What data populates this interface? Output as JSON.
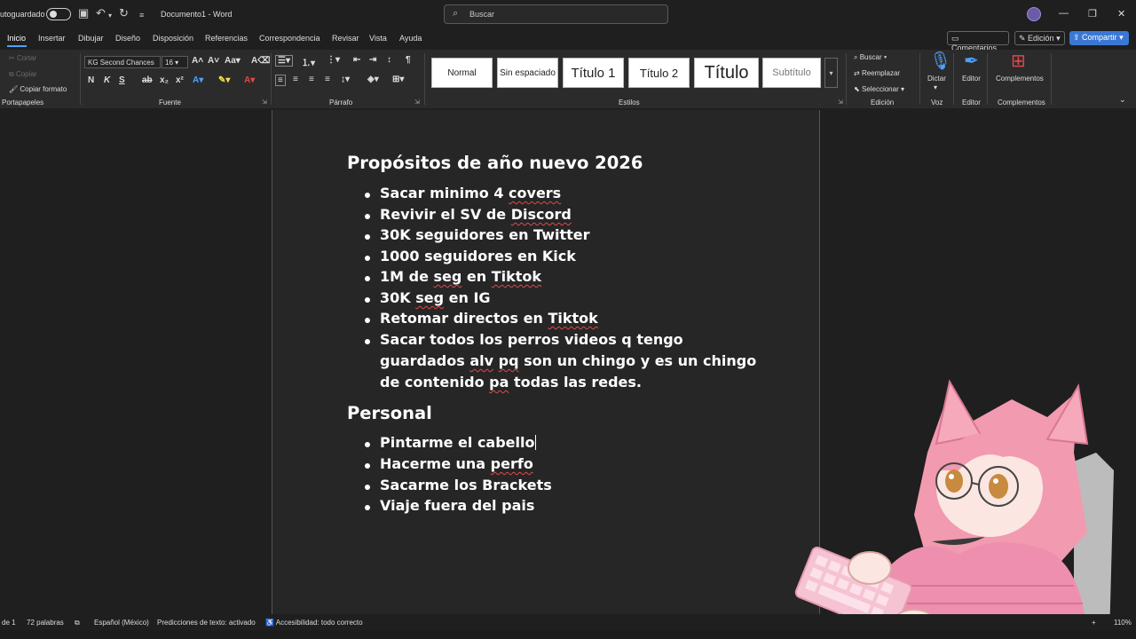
{
  "titlebar": {
    "autosave_label": "utoguardado",
    "doc_title": "Documento1 - Word",
    "search_placeholder": "Buscar"
  },
  "tabs": [
    "Inicio",
    "Insertar",
    "Dibujar",
    "Diseño",
    "Disposición",
    "Referencias",
    "Correspondencia",
    "Revisar",
    "Vista",
    "Ayuda"
  ],
  "actions": {
    "comments": "Comentarios",
    "edit": "Edición",
    "share": "Compartir"
  },
  "ribbon": {
    "clipboard": {
      "cut": "Cortar",
      "copy": "Copiar",
      "format_painter": "Copiar formato",
      "label": "Portapapeles"
    },
    "font": {
      "name": "KG Second Chances",
      "size": "16",
      "label": "Fuente"
    },
    "paragraph": {
      "label": "Párrafo"
    },
    "styles": {
      "items": [
        "Normal",
        "Sin espaciado",
        "Título 1",
        "Título 2",
        "Título",
        "Subtítulo"
      ],
      "label": "Estilos"
    },
    "editing": {
      "find": "Buscar",
      "replace": "Reemplazar",
      "select": "Seleccionar",
      "label": "Edición"
    },
    "voice": {
      "dictate": "Dictar",
      "label": "Voz"
    },
    "editor": {
      "button": "Editor",
      "label": "Editor"
    },
    "addins": {
      "button": "Complementos",
      "label": "Complementos"
    }
  },
  "document": {
    "heading1": "Propósitos de año nuevo 2026",
    "list1": {
      "i0_a": "Sacar minimo 4 ",
      "i0_b": "covers",
      "i1_a": "Revivir el SV de ",
      "i1_b": "Discord",
      "i2": "30K seguidores en Twitter",
      "i3": "1000 seguidores en Kick",
      "i4_a": "1M de ",
      "i4_b": "seg",
      "i4_c": " en ",
      "i4_d": "Tiktok",
      "i5_a": "30K ",
      "i5_b": "seg",
      "i5_c": " en IG",
      "i6_a": "Retomar directos en ",
      "i6_b": "Tiktok",
      "i7_l1": "Sacar todos los perros videos q tengo",
      "i7_l2_a": "guardados ",
      "i7_l2_b": "alv",
      "i7_l2_c": " ",
      "i7_l2_d": "pq",
      "i7_l2_e": " son un chingo y es un chingo",
      "i7_l3_a": "de contenido ",
      "i7_l3_b": "pa",
      "i7_l3_c": " todas las redes."
    },
    "heading2": "Personal",
    "list2": {
      "i0": "Pintarme el cabello",
      "i1_a": "Hacerme una ",
      "i1_b": "perfo",
      "i2": "Sacarme los Brackets",
      "i3": "Viaje fuera del pais"
    }
  },
  "statusbar": {
    "page": "de 1",
    "words": "72 palabras",
    "language": "Español (México)",
    "predictions": "Predicciones de texto: activado",
    "accessibility": "Accesibilidad: todo correcto",
    "zoom": "110%"
  },
  "colors": {
    "accent": "#4ea1ff",
    "share": "#3a78d4",
    "spell": "#e04848",
    "page": "#262626"
  }
}
